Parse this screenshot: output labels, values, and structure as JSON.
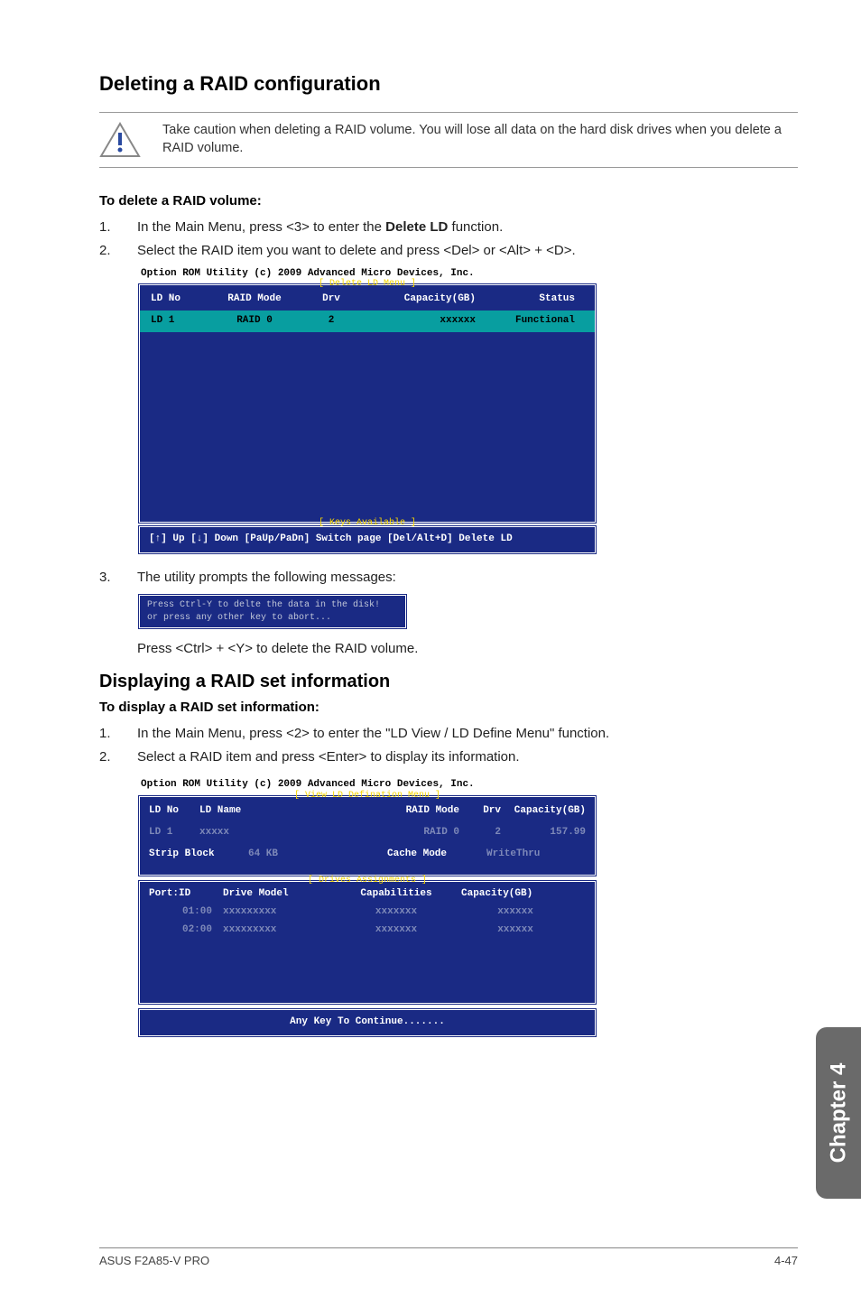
{
  "headings": {
    "h_delete_config": "Deleting a RAID configuration",
    "h_display_info": "Displaying a RAID set information"
  },
  "caution": {
    "text": "Take caution when deleting a RAID volume. You will lose all data on the hard disk drives when you delete a RAID volume."
  },
  "sections": {
    "delete": {
      "subhead": "To delete a RAID volume:",
      "steps": {
        "s1": "In the Main Menu, press <3> to enter the Delete LD function.",
        "s1_bold": "Delete LD",
        "s2": "Select the RAID item you want to delete and press <Del> or <Alt> + <D>.",
        "s3": "The utility prompts the following messages:",
        "after_prompt": "Press <Ctrl> + <Y> to delete the RAID volume."
      }
    },
    "display": {
      "subhead": "To display a RAID set information:",
      "steps": {
        "s1": "In the Main Menu, press <2> to enter the \"LD View / LD Define Menu\" function.",
        "s2": "Select a RAID item and press <Enter> to display its information."
      }
    }
  },
  "bios1": {
    "title": "Option ROM Utility (c) 2009 Advanced Micro Devices, Inc.",
    "menu_label": "[ Delete LD Menu ]",
    "headers": {
      "ld_no": "LD No",
      "raid_mode": "RAID Mode",
      "drv": "Drv",
      "capacity": "Capacity(GB)",
      "status": "Status"
    },
    "row": {
      "ld_no": "LD  1",
      "raid_mode": "RAID 0",
      "drv": "2",
      "capacity": "xxxxxx",
      "status": "Functional"
    },
    "keys_label": "[ Keys Available ]",
    "keys": "[↑] Up  [↓] Down  [PaUp/PaDn] Switch page  [Del/Alt+D] Delete LD"
  },
  "prompt": {
    "line1": "Press Ctrl-Y to delte the data in the disk!",
    "line2": "or press any other key to abort..."
  },
  "bios2": {
    "title": "Option ROM Utility (c) 2009 Advanced Micro Devices, Inc.",
    "menu_label": "[ View LD Defination Menu ]",
    "headers": {
      "ld_no": "LD No",
      "ld_name": "LD Name",
      "raid_mode": "RAID Mode",
      "drv": "Drv",
      "capacity": "Capacity(GB)"
    },
    "row": {
      "ld_no": "LD  1",
      "ld_name": "xxxxx",
      "raid_mode": "RAID 0",
      "drv": "2",
      "capacity": "157.99"
    },
    "detail": {
      "strip_label": "Strip Block",
      "strip_val": "64 KB",
      "cache_label": "Cache Mode",
      "cache_val": "WriteThru"
    },
    "drives_label": "[ Drives Assignments ]",
    "drives_headers": {
      "port": "Port:ID",
      "model": "Drive Model",
      "cap": "Capabilities",
      "capacity": "Capacity(GB)"
    },
    "drives_rows": [
      {
        "port": "01:00",
        "model": "xxxxxxxxx",
        "cap": "xxxxxxx",
        "capacity": "xxxxxx"
      },
      {
        "port": "02:00",
        "model": "xxxxxxxxx",
        "cap": "xxxxxxx",
        "capacity": "xxxxxx"
      }
    ],
    "continue": "Any Key To Continue......."
  },
  "footer": {
    "product": "ASUS F2A85-V PRO",
    "page": "4-47"
  },
  "tab": {
    "label": "Chapter 4"
  }
}
